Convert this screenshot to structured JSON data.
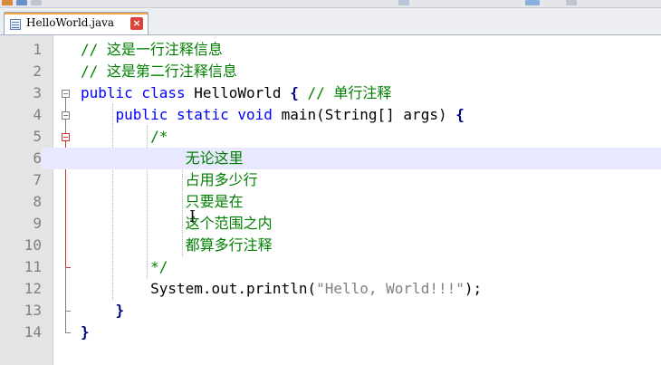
{
  "tabs": [
    {
      "label": "HelloWorld.java",
      "close_label": "×",
      "active": true
    }
  ],
  "editor": {
    "current_line": 6,
    "lines": [
      {
        "num": "1",
        "indent": "",
        "parts": [
          {
            "t": "// 这是一行注释信息",
            "c": "comment"
          }
        ]
      },
      {
        "num": "2",
        "indent": "",
        "parts": [
          {
            "t": "// 这是第二行注释信息",
            "c": "comment"
          }
        ]
      },
      {
        "num": "3",
        "indent": "",
        "parts": [
          {
            "t": "public class ",
            "c": "kw"
          },
          {
            "t": "HelloWorld ",
            "c": "plain"
          },
          {
            "t": "{",
            "c": "brace"
          },
          {
            "t": " // 单行注释",
            "c": "comment"
          }
        ]
      },
      {
        "num": "4",
        "indent": "    ",
        "parts": [
          {
            "t": "public static void ",
            "c": "kw"
          },
          {
            "t": "main(String[] args) ",
            "c": "plain"
          },
          {
            "t": "{",
            "c": "brace"
          }
        ]
      },
      {
        "num": "5",
        "indent": "        ",
        "parts": [
          {
            "t": "/*",
            "c": "comment"
          }
        ]
      },
      {
        "num": "6",
        "indent": "            ",
        "parts": [
          {
            "t": "无论这里",
            "c": "comment"
          }
        ]
      },
      {
        "num": "7",
        "indent": "            ",
        "parts": [
          {
            "t": "占用多少行",
            "c": "comment"
          }
        ]
      },
      {
        "num": "8",
        "indent": "            ",
        "parts": [
          {
            "t": "只要是在",
            "c": "comment"
          }
        ]
      },
      {
        "num": "9",
        "indent": "            ",
        "parts": [
          {
            "t": "这个范围之内",
            "c": "comment"
          }
        ]
      },
      {
        "num": "10",
        "indent": "            ",
        "parts": [
          {
            "t": "都算多行注释",
            "c": "comment"
          }
        ]
      },
      {
        "num": "11",
        "indent": "        ",
        "parts": [
          {
            "t": "*/",
            "c": "comment"
          }
        ]
      },
      {
        "num": "12",
        "indent": "        ",
        "parts": [
          {
            "t": "System.out.println(",
            "c": "plain"
          },
          {
            "t": "\"Hello, World!!!\"",
            "c": "str"
          },
          {
            "t": ");",
            "c": "plain"
          }
        ]
      },
      {
        "num": "13",
        "indent": "    ",
        "parts": [
          {
            "t": "}",
            "c": "brace"
          }
        ]
      },
      {
        "num": "14",
        "indent": "",
        "parts": [
          {
            "t": "}",
            "c": "brace"
          }
        ]
      }
    ]
  },
  "colors": {
    "comment": "#008000",
    "keyword": "#0000ff",
    "string": "#808080",
    "brace": "#000080",
    "current_line_bg": "#e8e8ff",
    "fold_active": "#d03030"
  },
  "icons": [
    "file-icon",
    "close-icon",
    "fold-marker-icon",
    "text-cursor-icon"
  ]
}
